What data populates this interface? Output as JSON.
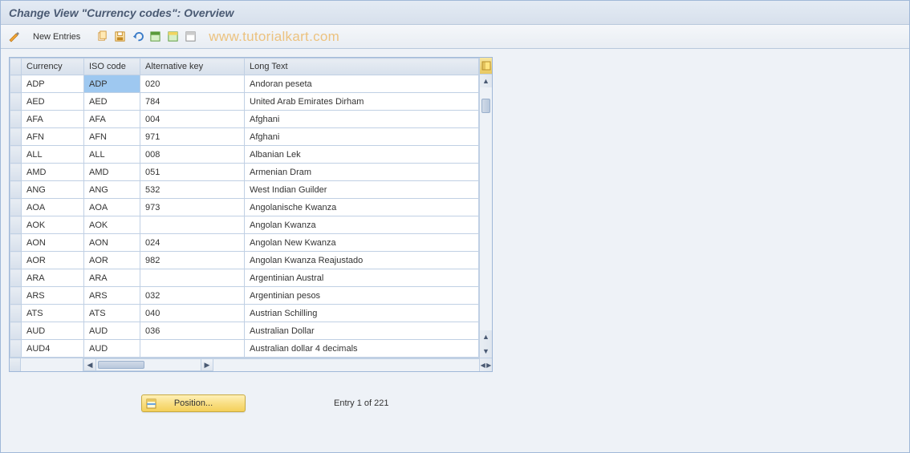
{
  "title": "Change View \"Currency codes\": Overview",
  "toolbar": {
    "new_entries": "New Entries"
  },
  "watermark": "www.tutorialkart.com",
  "columns": {
    "currency": "Currency",
    "iso": "ISO code",
    "alt": "Alternative key",
    "long": "Long Text"
  },
  "rows": [
    {
      "currency": "ADP",
      "iso": "ADP",
      "alt": "020",
      "long": "Andoran peseta"
    },
    {
      "currency": "AED",
      "iso": "AED",
      "alt": "784",
      "long": "United Arab Emirates Dirham"
    },
    {
      "currency": "AFA",
      "iso": "AFA",
      "alt": "004",
      "long": "Afghani"
    },
    {
      "currency": "AFN",
      "iso": "AFN",
      "alt": "971",
      "long": "Afghani"
    },
    {
      "currency": "ALL",
      "iso": "ALL",
      "alt": "008",
      "long": "Albanian Lek"
    },
    {
      "currency": "AMD",
      "iso": "AMD",
      "alt": "051",
      "long": "Armenian Dram"
    },
    {
      "currency": "ANG",
      "iso": "ANG",
      "alt": "532",
      "long": "West Indian Guilder"
    },
    {
      "currency": "AOA",
      "iso": "AOA",
      "alt": "973",
      "long": "Angolanische Kwanza"
    },
    {
      "currency": "AOK",
      "iso": "AOK",
      "alt": "",
      "long": "Angolan Kwanza"
    },
    {
      "currency": "AON",
      "iso": "AON",
      "alt": "024",
      "long": "Angolan New Kwanza"
    },
    {
      "currency": "AOR",
      "iso": "AOR",
      "alt": "982",
      "long": "Angolan Kwanza Reajustado"
    },
    {
      "currency": "ARA",
      "iso": "ARA",
      "alt": "",
      "long": "Argentinian Austral"
    },
    {
      "currency": "ARS",
      "iso": "ARS",
      "alt": "032",
      "long": "Argentinian pesos"
    },
    {
      "currency": "ATS",
      "iso": "ATS",
      "alt": "040",
      "long": "Austrian Schilling"
    },
    {
      "currency": "AUD",
      "iso": "AUD",
      "alt": "036",
      "long": "Australian Dollar"
    },
    {
      "currency": "AUD4",
      "iso": "AUD",
      "alt": "",
      "long": "Australian dollar 4 decimals"
    }
  ],
  "footer": {
    "position": "Position...",
    "entry": "Entry 1 of 221"
  }
}
